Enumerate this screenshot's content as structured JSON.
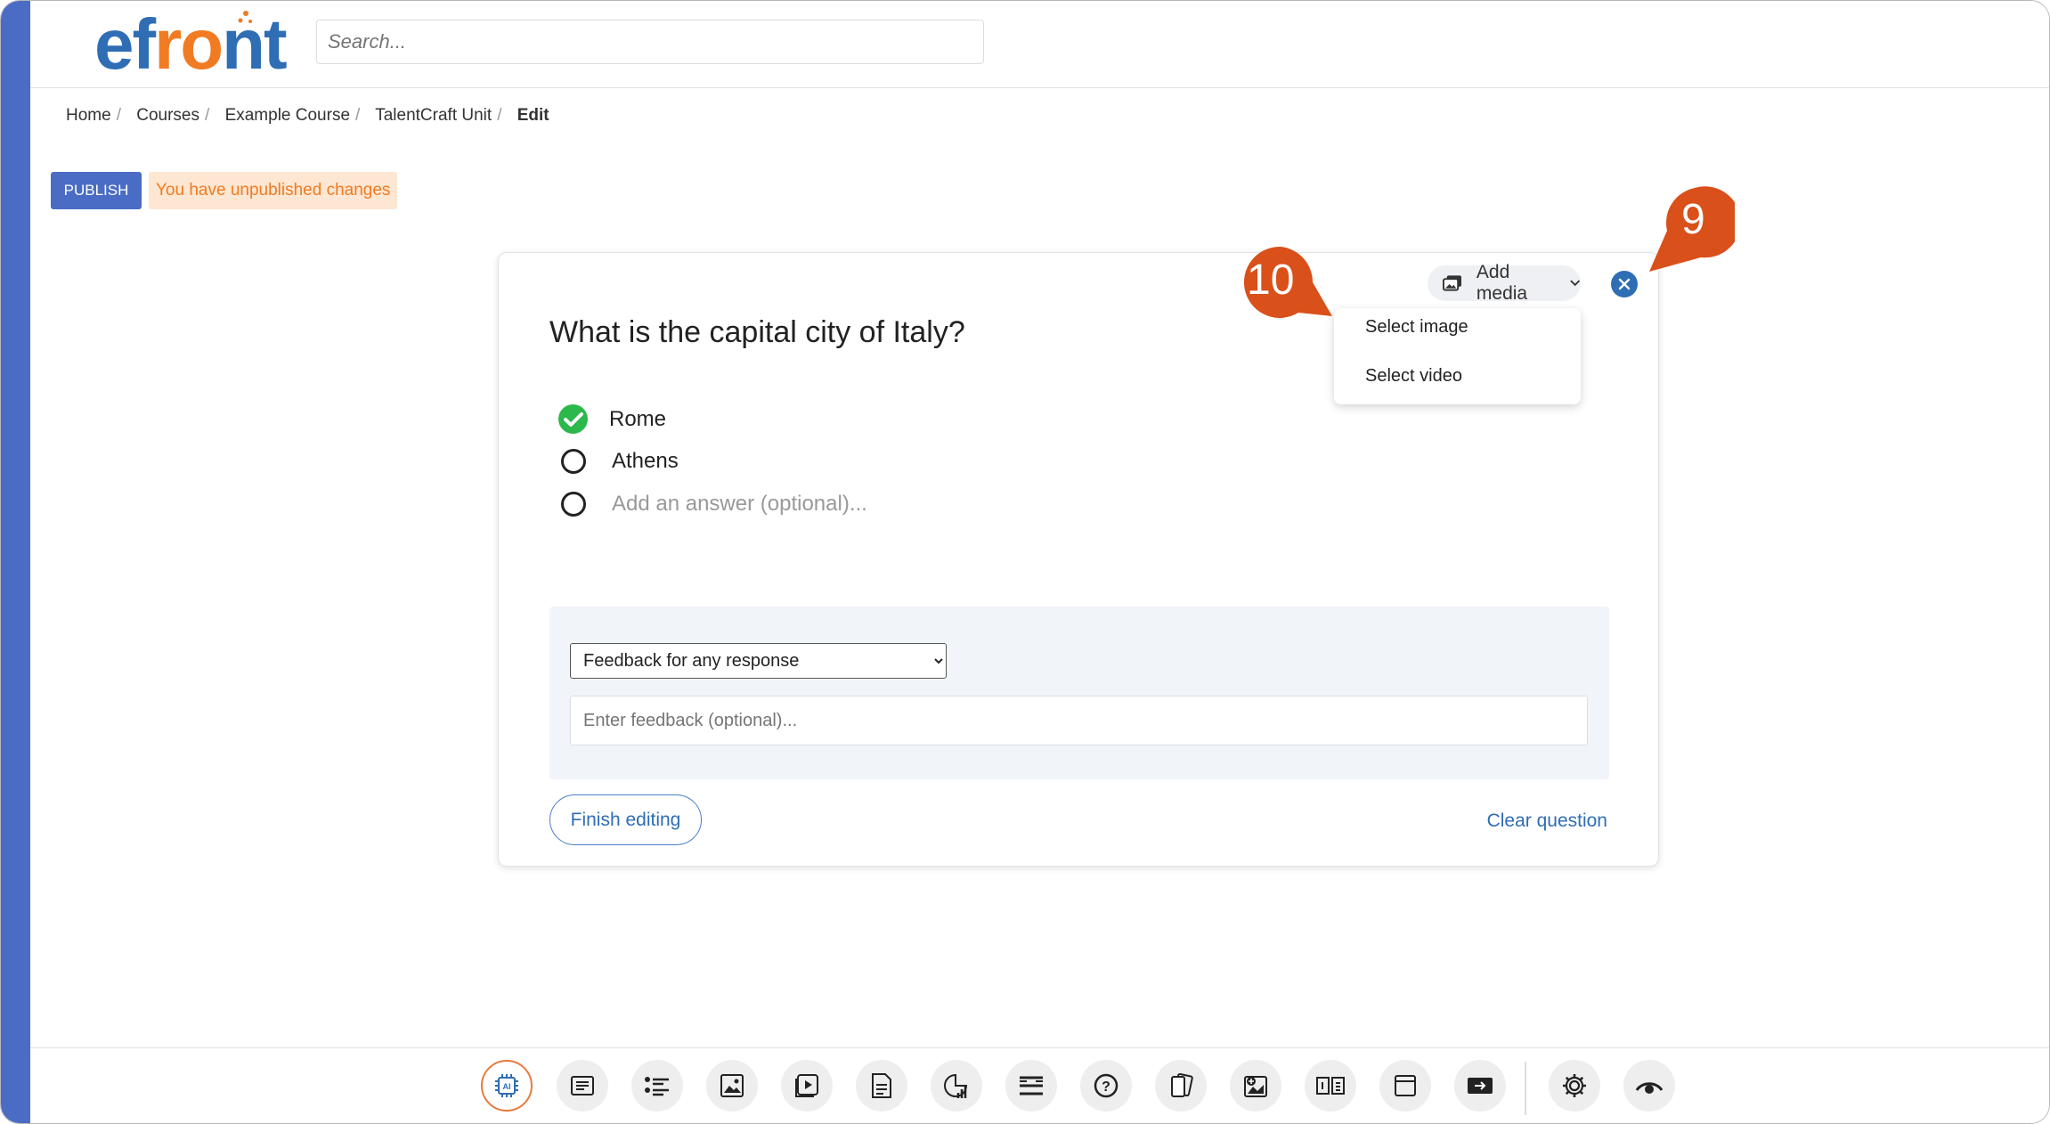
{
  "app": {
    "logo_text": "efront"
  },
  "header": {
    "search_placeholder": "Search..."
  },
  "breadcrumb": {
    "items": [
      "Home",
      "Courses",
      "Example Course",
      "TalentCraft Unit"
    ],
    "current": "Edit"
  },
  "toolbar": {
    "publish_label": "PUBLISH",
    "status_text": "You have unpublished changes"
  },
  "question": {
    "text": "What is the capital city of Italy?",
    "answers": [
      {
        "label": "Rome",
        "correct": true
      },
      {
        "label": "Athens",
        "correct": false
      }
    ],
    "add_answer_placeholder": "Add an answer (optional)..."
  },
  "feedback": {
    "select_value": "Feedback for any response",
    "input_placeholder": "Enter feedback (optional)..."
  },
  "actions": {
    "finish_label": "Finish editing",
    "clear_label": "Clear question"
  },
  "media": {
    "add_label": "Add media",
    "menu": [
      "Select image",
      "Select video"
    ]
  },
  "callouts": {
    "nine": "9",
    "ten": "10"
  },
  "colors": {
    "brand_blue": "#2f6db5",
    "brand_orange": "#f07b22",
    "sidebar": "#4a6cc5",
    "callout": "#d9501a",
    "correct": "#2cb84a"
  },
  "bottom_toolbar": {
    "icons": [
      "ai-icon",
      "text-icon",
      "list-icon",
      "image-icon",
      "video-icon",
      "document-icon",
      "chart-icon",
      "lines-icon",
      "question-icon",
      "cards-icon",
      "image-plus-icon",
      "layout-icon",
      "window-icon",
      "slide-icon",
      "settings-icon",
      "preview-icon"
    ]
  }
}
